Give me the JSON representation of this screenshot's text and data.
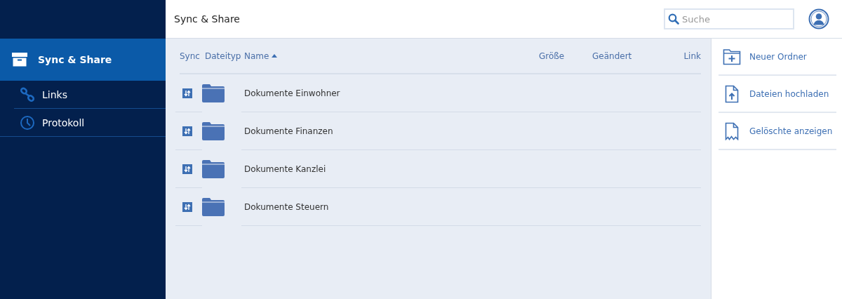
{
  "sidebar": {
    "items": [
      {
        "label": "Sync & Share",
        "kind": "box",
        "selected": true,
        "children": [
          {
            "label": "Links",
            "kind": "link",
            "selected": false
          },
          {
            "label": "Protokoll",
            "kind": "clock",
            "selected": false
          }
        ]
      }
    ]
  },
  "header": {
    "title": "Sync & Share",
    "search": {
      "placeholder": "Suche"
    }
  },
  "table": {
    "columns": [
      {
        "label": "Sync",
        "sorted": false
      },
      {
        "label": "Dateityp",
        "sorted": false
      },
      {
        "label": "Name",
        "sorted": true
      },
      {
        "label": "Größe",
        "sorted": false
      },
      {
        "label": "Geändert",
        "sorted": false
      },
      {
        "label": "Link",
        "sorted": false
      }
    ],
    "rows": [
      {
        "name": "Dokumente Einwohner",
        "kind": "folder",
        "sync": true
      },
      {
        "name": "Dokumente Finanzen",
        "kind": "folder",
        "sync": true
      },
      {
        "name": "Dokumente Kanzlei",
        "kind": "folder",
        "sync": true
      },
      {
        "name": "Dokumente Steuern",
        "kind": "folder",
        "sync": true
      }
    ]
  },
  "actions": [
    {
      "label": "Neuer Ordner",
      "kind": "new-folder"
    },
    {
      "label": "Dateien hochladen",
      "kind": "upload"
    },
    {
      "label": "Gelöschte anzeigen",
      "kind": "bookmark"
    }
  ]
}
